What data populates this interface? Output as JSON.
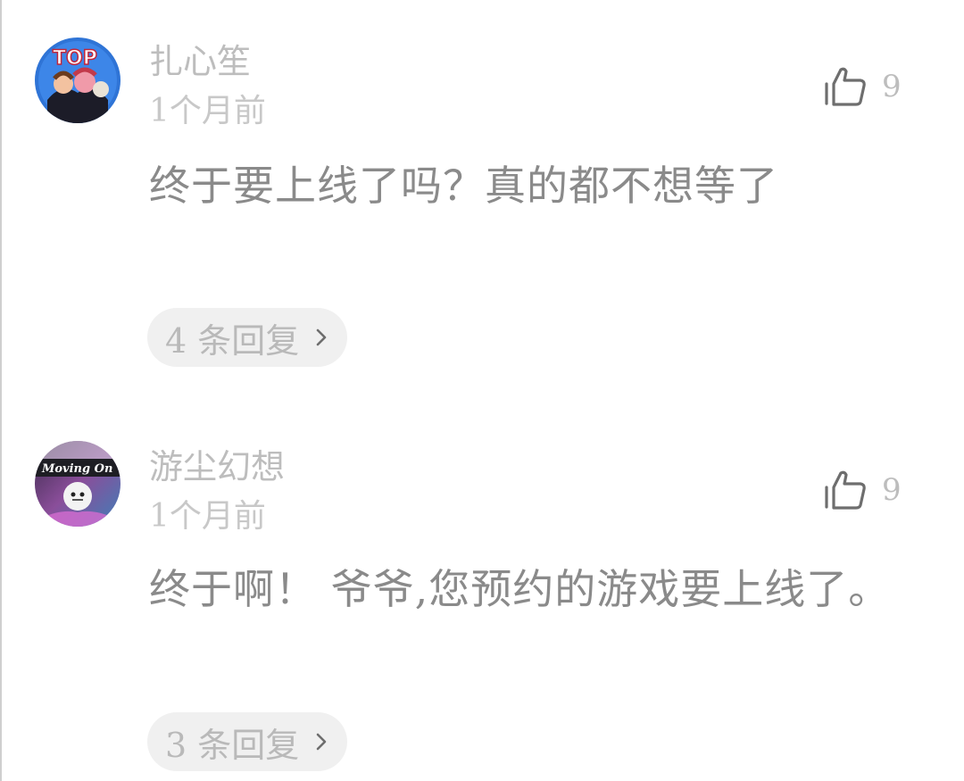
{
  "comments": [
    {
      "username": "扎心笙",
      "time": "1个月前",
      "likes": "9",
      "text": "终于要上线了吗？真的都不想等了",
      "replies_label": "4 条回复",
      "avatar_text": "TOP"
    },
    {
      "username": "游尘幻想",
      "time": "1个月前",
      "likes": "9",
      "text": "终于啊！ 爷爷,您预约的游戏要上线了。",
      "replies_label": "3 条回复",
      "avatar_text": "Moving On"
    }
  ],
  "icons": {
    "like": "thumbs-up-icon",
    "chevron": "chevron-right-icon"
  },
  "colors": {
    "reply_pill_bg": "#f0f0f0",
    "muted_text": "#bdbdbd",
    "content_text": "#8a8a8a"
  }
}
